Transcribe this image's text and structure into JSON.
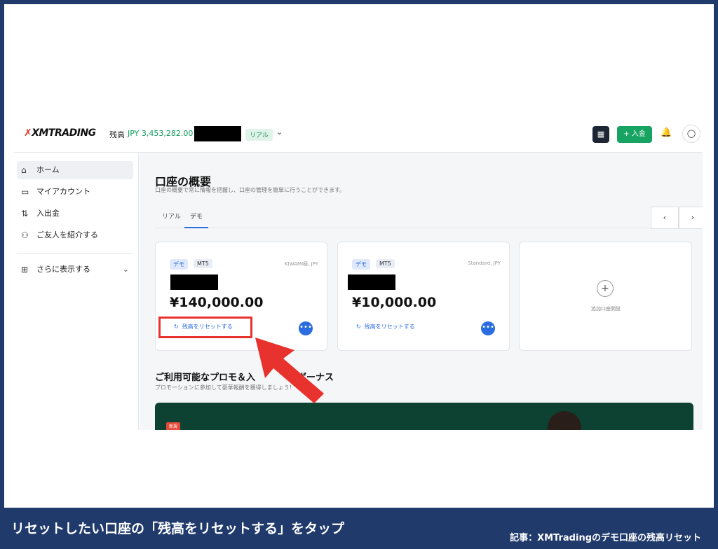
{
  "header": {
    "logo_x": "✗",
    "logo_text": "XMTRADING",
    "balance_label": "残高",
    "balance_value": "JPY 3,453,282.00",
    "account_badge": "リアル",
    "deposit_button": "+ 入金"
  },
  "sidebar": {
    "items": [
      {
        "label": "ホーム",
        "icon": "home-icon"
      },
      {
        "label": "マイアカウント",
        "icon": "card-icon"
      },
      {
        "label": "入出金",
        "icon": "transfer-icon"
      },
      {
        "label": "ご友人を紹介する",
        "icon": "referral-icon"
      }
    ],
    "more_label": "さらに表示する"
  },
  "main": {
    "title": "口座の概要",
    "subtitle": "口座の概要で常に情報を把握し、口座の管理を簡単に行うことができます。",
    "tabs": [
      "リアル",
      "デモ"
    ],
    "active_tab": "デモ",
    "prev": "‹",
    "next": "›"
  },
  "accounts": [
    {
      "tag": "デモ",
      "platform": "MT5",
      "type": "KIWAMI極, JPY",
      "amount": "¥140,000.00",
      "reset_label": "残高をリセットする"
    },
    {
      "tag": "デモ",
      "platform": "MT5",
      "type": "Standard, JPY",
      "amount": "¥10,000.00",
      "reset_label": "残高をリセットする"
    }
  ],
  "add_account": {
    "label": "追加口座開設"
  },
  "promo": {
    "title": "ご利用可能なプロモ＆入",
    "title_tail": "ボーナス",
    "subtitle": "プロモーションに参加して豪華報酬を獲得しましょう！",
    "badge": "新規"
  },
  "caption": {
    "instruction": "リセットしたい口座の「残高をリセットする」をタップ",
    "article": "記事：XMTradingのデモ口座の残高リセット"
  },
  "colors": {
    "accent": "#2b6de0",
    "deposit_green": "#17a361",
    "highlight_red": "#e8322d",
    "banner_blue": "#1f3a6b"
  }
}
